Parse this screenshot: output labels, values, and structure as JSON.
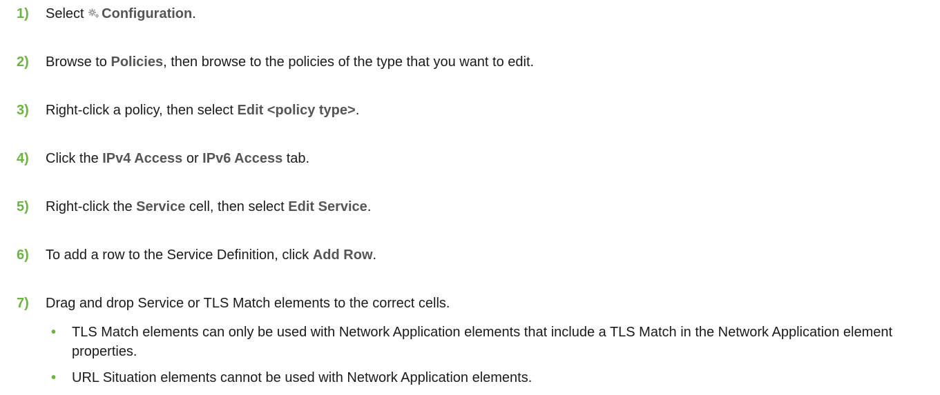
{
  "steps": [
    {
      "num": "1)",
      "parts": [
        "Select ",
        "Configuration",
        "."
      ]
    },
    {
      "num": "2)",
      "parts": [
        "Browse to ",
        "Policies",
        ", then browse to the policies of the type that you want to edit."
      ]
    },
    {
      "num": "3)",
      "parts": [
        "Right-click a policy, then select ",
        "Edit <policy type>",
        "."
      ]
    },
    {
      "num": "4)",
      "parts": [
        "Click the ",
        "IPv4 Access",
        " or ",
        "IPv6 Access",
        " tab."
      ]
    },
    {
      "num": "5)",
      "parts": [
        "Right-click the ",
        "Service",
        " cell, then select ",
        "Edit Service",
        "."
      ]
    },
    {
      "num": "6)",
      "parts": [
        "To add a row to the Service Definition, click ",
        "Add Row",
        "."
      ]
    },
    {
      "num": "7)",
      "parts": [
        "Drag and drop Service or TLS Match elements to the correct cells."
      ]
    }
  ],
  "bullets": [
    {
      "marker": "•",
      "text": "TLS Match elements can only be used with Network Application elements that include a TLS Match in the Network Application element properties."
    },
    {
      "marker": "•",
      "text": "URL Situation elements cannot be used with Network Application elements."
    }
  ],
  "icons": {
    "configuration": "gear-icon"
  },
  "colors": {
    "step_number": "#6cb33f",
    "ui_term": "#555555",
    "body_text": "#1a1a1a"
  }
}
